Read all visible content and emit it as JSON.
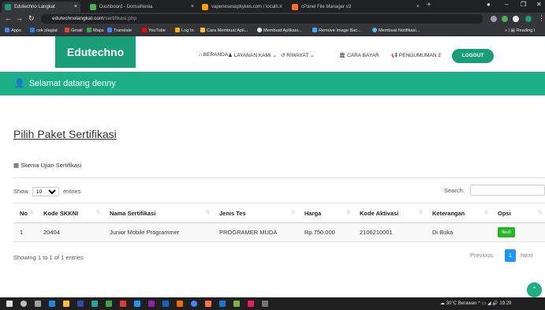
{
  "browser": {
    "tabs": [
      {
        "label": "Edutechno Langkat",
        "color": "#1a9e77"
      },
      {
        "label": "Dashboard - DomaiNesia",
        "color": "#4caf50"
      },
      {
        "label": "vapenesesepkykes.com / localh...",
        "color": "#f4a300"
      },
      {
        "label": "cPanel File Manager v3",
        "color": "#ff6c2c"
      }
    ],
    "url_host": "edutechnolangkat.com",
    "url_path": "/sertifikasi.php",
    "bookmarks": [
      "Apps",
      "cek plagiat",
      "Gmail",
      "Maps",
      "Translate",
      "YouTube",
      "Log In",
      "Cara Membuat Apli...",
      "Membuat Aplikasi...",
      "Remove Image Bac...",
      "Membuat Notifikasi..."
    ],
    "reading_list": "Reading l",
    "new_tab": "+"
  },
  "site": {
    "brand": "Edutechno",
    "menu": [
      {
        "label": "BERANDA",
        "icon": "home-icon"
      },
      {
        "label": "LAYANAN KAMI",
        "icon": "users-icon"
      },
      {
        "label": "RIWAYAT",
        "icon": "history-icon"
      },
      {
        "label": "CARA BAYAR",
        "icon": "bank-icon"
      },
      {
        "label": "PENGUMUMAN",
        "icon": "megaphone-icon",
        "badge": "2"
      }
    ],
    "logout": "LOGOUT",
    "welcome": "Selamat datang denny",
    "accent": "#1cae86"
  },
  "main": {
    "title": "Pilih Paket Sertifikasi",
    "card_title": "Skema Ujian Sertifikasi",
    "show_label": "Show",
    "entries_value": "10",
    "entries_label": "entries",
    "search_label": "Search:",
    "columns": [
      "No",
      "Kode SKKNI",
      "Nama Sertifikasi",
      "Jenis Tes",
      "Harga",
      "Kode Aktivasi",
      "Keterangan",
      "Opsi"
    ],
    "rows": [
      {
        "no": "1",
        "kode": "20404",
        "nama": "Junior Mobile Programmer",
        "jenis": "PROGRAMER MUDA",
        "harga": "Rp.750.000",
        "aktivasi": "2106210001",
        "keterangan": "Di Buka",
        "opsi": "Ikuti"
      }
    ],
    "info": "Showing 1 to 1 of 1 entries",
    "pager": {
      "previous": "Previous",
      "page": "1",
      "next": "Next"
    }
  },
  "taskbar": {
    "weather": "30°C Berawan",
    "time": "19:29"
  }
}
